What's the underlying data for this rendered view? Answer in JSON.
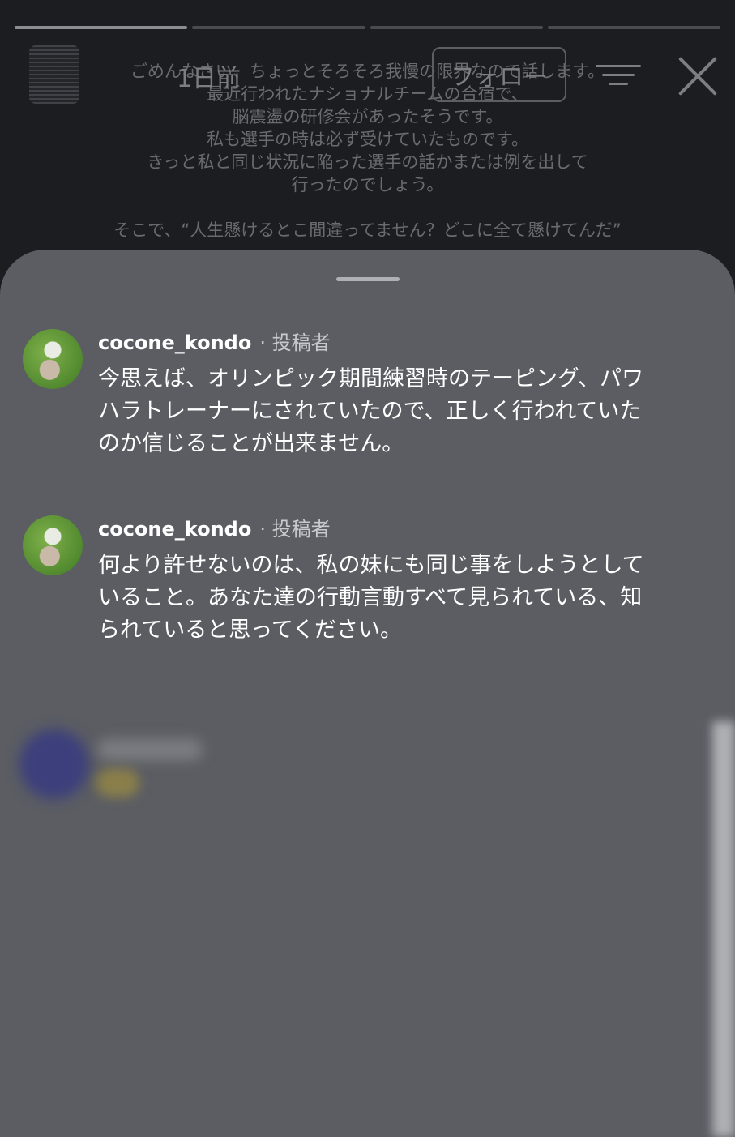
{
  "story": {
    "time": "1日前",
    "follow_label": "フォロー",
    "text": "ごめんなさい、ちょっとそろそろ我慢の限界なので話します。\n最近行われたナショナルチームの合宿で、\n脳震盪の研修会があったそうです。\n私も選手の時は必ず受けていたものです。\nきっと私と同じ状況に陥った選手の話かまたは例を出して\n行ったのでしょう。\n\nそこで、“人生懸けるとこ間違ってません？どこに全て懸けてんだ”"
  },
  "comments": [
    {
      "username": "cocone_kondo",
      "meta": "· 投稿者",
      "text": "今思えば、オリンピック期間練習時のテーピング、パワハラトレーナーにされていたので、正しく行われていたのか信じることが出来ません。"
    },
    {
      "username": "cocone_kondo",
      "meta": "· 投稿者",
      "text": "何より許せないのは、私の妹にも同じ事をしようとしていること。あなた達の行動言動すべて見られている、知られていると思ってください。"
    }
  ]
}
